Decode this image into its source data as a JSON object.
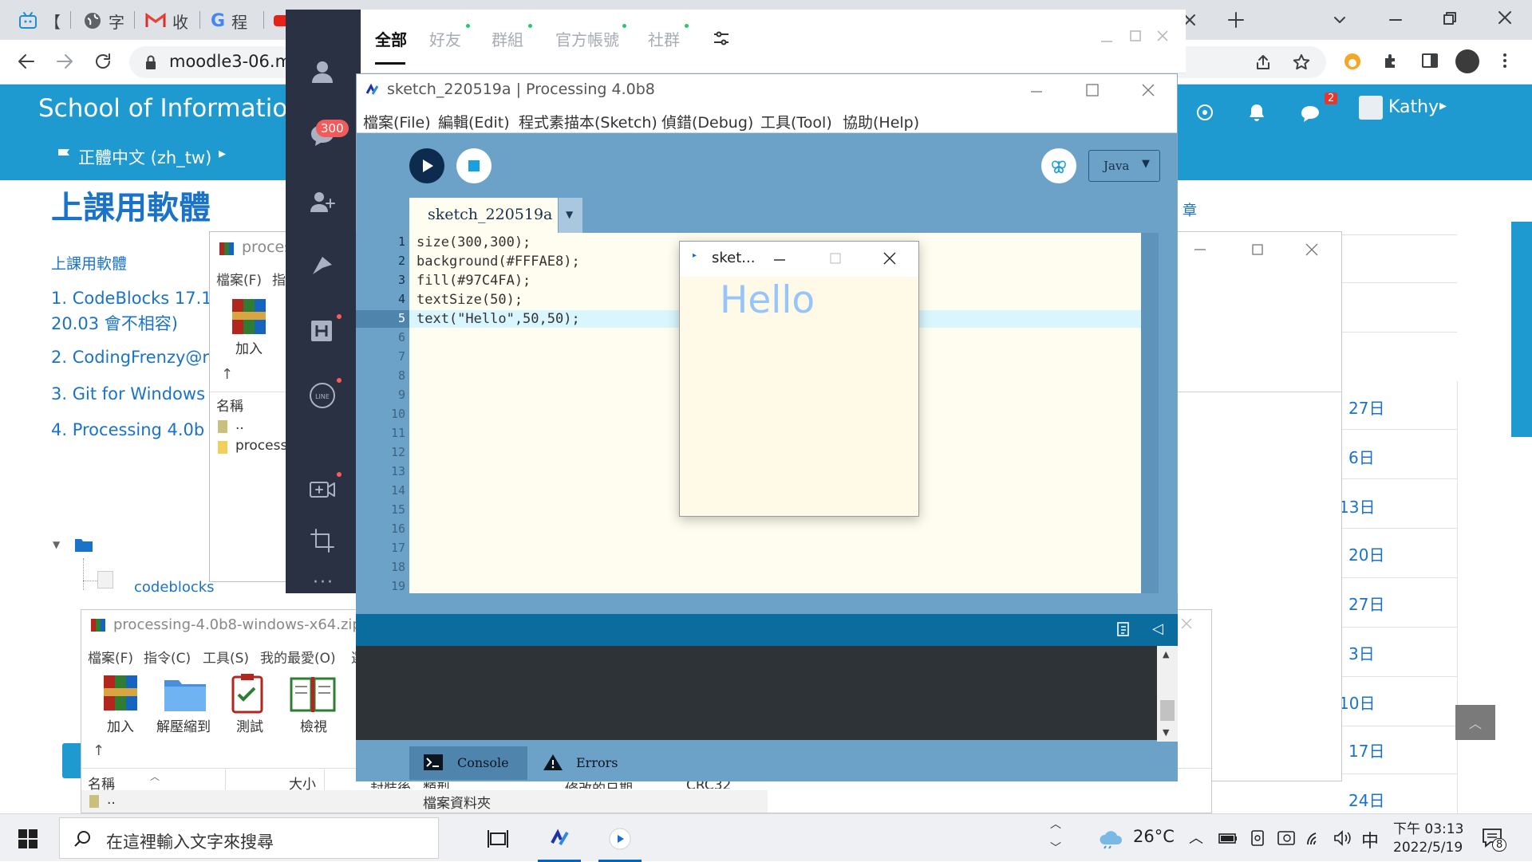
{
  "browser": {
    "tabs": [
      {
        "label": "【"
      },
      {
        "label": "字"
      },
      {
        "label": "收"
      },
      {
        "label": "程"
      }
    ],
    "address": "moodle3-06.m"
  },
  "moodle": {
    "site_title": "School of Informatio",
    "language": "正體中文 (zh_tw)",
    "user_name": "Kathy",
    "message_badge": "2",
    "page_heading": "上課用軟體",
    "breadcrumb": "上課用軟體",
    "items": [
      {
        "text": "1. CodeBlocks 17.1"
      },
      {
        "text": "20.03 會不相容)"
      },
      {
        "text": "2. CodingFrenzy@r"
      },
      {
        "text": "3. Git for Windows"
      },
      {
        "text": "4. Processing 4.0b"
      }
    ],
    "folder_item": "codeblocks",
    "right_label": "章",
    "calendar_days": [
      "27日",
      "6日",
      "13日",
      "20日",
      "27日",
      "3日",
      "10日",
      "17日",
      "24日"
    ]
  },
  "line": {
    "tabs": [
      "全部",
      "好友",
      "群組",
      "官方帳號",
      "社群"
    ],
    "chat_badge": "300"
  },
  "winrar_back": {
    "title": "proces",
    "menu": [
      "檔案(F)",
      "指"
    ],
    "add_label": "加入",
    "col_name": "名稱",
    "rows": [
      "..",
      "process"
    ]
  },
  "winrar_front": {
    "title": "processing-4.0b8-windows-x64.zip (",
    "menu": [
      "檔案(F)",
      "指令(C)",
      "工具(S)",
      "我的最愛(O)",
      "選"
    ],
    "tools": [
      "加入",
      "解壓縮到",
      "測試",
      "檢視"
    ],
    "columns": [
      "名稱",
      "大小",
      "封裝後",
      "類型",
      "修改的日期",
      "CRC32"
    ],
    "row_name": "..",
    "row_type": "檔案資料夾"
  },
  "processing": {
    "title": "sketch_220519a | Processing 4.0b8",
    "menu": [
      "檔案(File)",
      "編輯(Edit)",
      "程式素描本(Sketch)",
      "偵錯(Debug)",
      "工具(Tool)",
      "協助(Help)"
    ],
    "tab_name": "sketch_220519a",
    "mode": "Java",
    "code": [
      "size(300,300);",
      "background(#FFFAE8);",
      "fill(#97C4FA);",
      "textSize(50);",
      "text(\"Hello\",50,50);"
    ],
    "line_numbers": [
      "1",
      "2",
      "3",
      "4",
      "5",
      "6",
      "7",
      "8",
      "9",
      "10",
      "11",
      "12",
      "13",
      "14",
      "15",
      "16",
      "17",
      "18",
      "19"
    ],
    "console_tab": "Console",
    "errors_tab": "Errors",
    "colors": {
      "bg": "#6CA2C8",
      "editor": "#FFFDEF",
      "console": "#2E3337"
    }
  },
  "sketch_window": {
    "title": "sket...",
    "text": "Hello",
    "background": "#FFFAE8",
    "fill": "#97C4FA"
  },
  "taskbar": {
    "search_placeholder": "在這裡輸入文字來搜尋",
    "weather": "26°C",
    "ime": "中",
    "time": "下午 03:13",
    "date": "2022/5/19",
    "notif_count": "8"
  }
}
